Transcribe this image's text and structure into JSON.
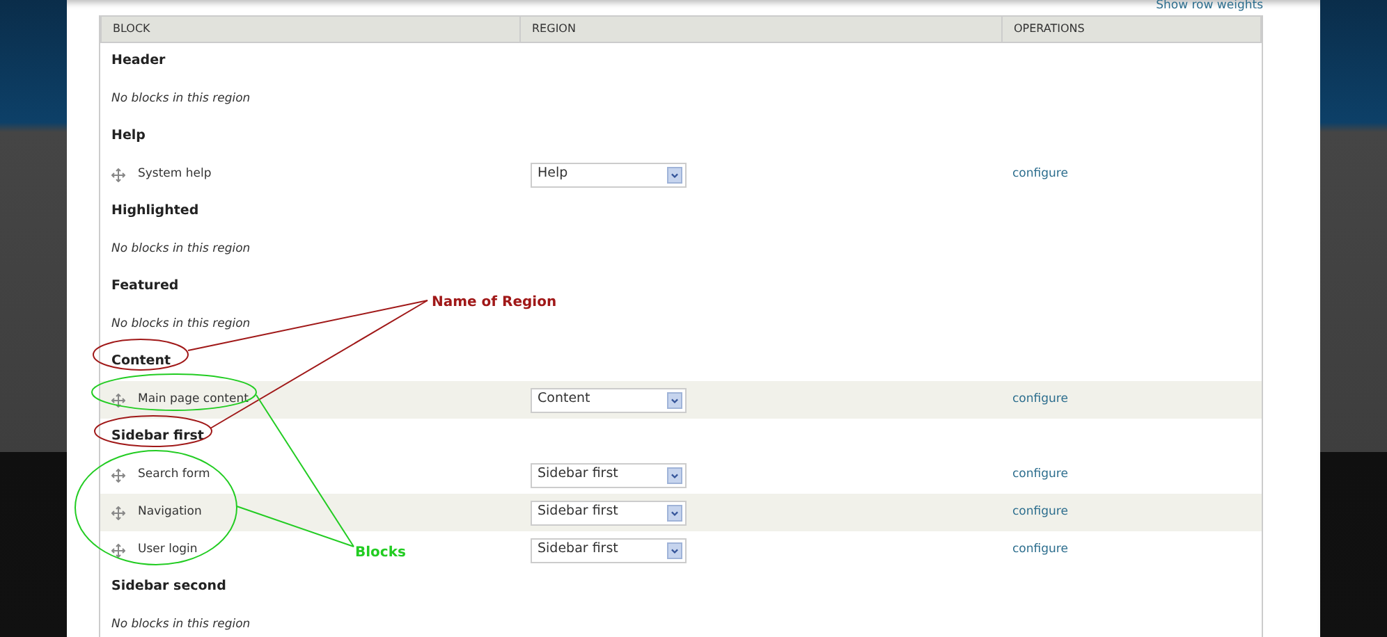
{
  "show_row_weights": "Show row weights",
  "table": {
    "columns": [
      "BLOCK",
      "REGION",
      "OPERATIONS"
    ],
    "rows": [
      {
        "kind": "region",
        "title": "Header"
      },
      {
        "kind": "empty",
        "text": "No blocks in this region"
      },
      {
        "kind": "region",
        "title": "Help"
      },
      {
        "kind": "block",
        "name": "System help",
        "region": "Help",
        "operation": "configure",
        "shaded": false
      },
      {
        "kind": "region",
        "title": "Highlighted"
      },
      {
        "kind": "empty",
        "text": "No blocks in this region"
      },
      {
        "kind": "region",
        "title": "Featured"
      },
      {
        "kind": "empty",
        "text": "No blocks in this region"
      },
      {
        "kind": "region",
        "title": "Content"
      },
      {
        "kind": "block",
        "name": "Main page content",
        "region": "Content",
        "operation": "configure",
        "shaded": true
      },
      {
        "kind": "region",
        "title": "Sidebar first"
      },
      {
        "kind": "block",
        "name": "Search form",
        "region": "Sidebar first",
        "operation": "configure",
        "shaded": false
      },
      {
        "kind": "block",
        "name": "Navigation",
        "region": "Sidebar first",
        "operation": "configure",
        "shaded": true
      },
      {
        "kind": "block",
        "name": "User login",
        "region": "Sidebar first",
        "operation": "configure",
        "shaded": false
      },
      {
        "kind": "region",
        "title": "Sidebar second"
      },
      {
        "kind": "empty",
        "text": "No blocks in this region"
      }
    ]
  },
  "annotations": [
    {
      "kind": "region",
      "label": "Name of Region",
      "color": "#a01818"
    },
    {
      "kind": "blocks",
      "label": "Blocks",
      "color": "#22cc22"
    }
  ]
}
